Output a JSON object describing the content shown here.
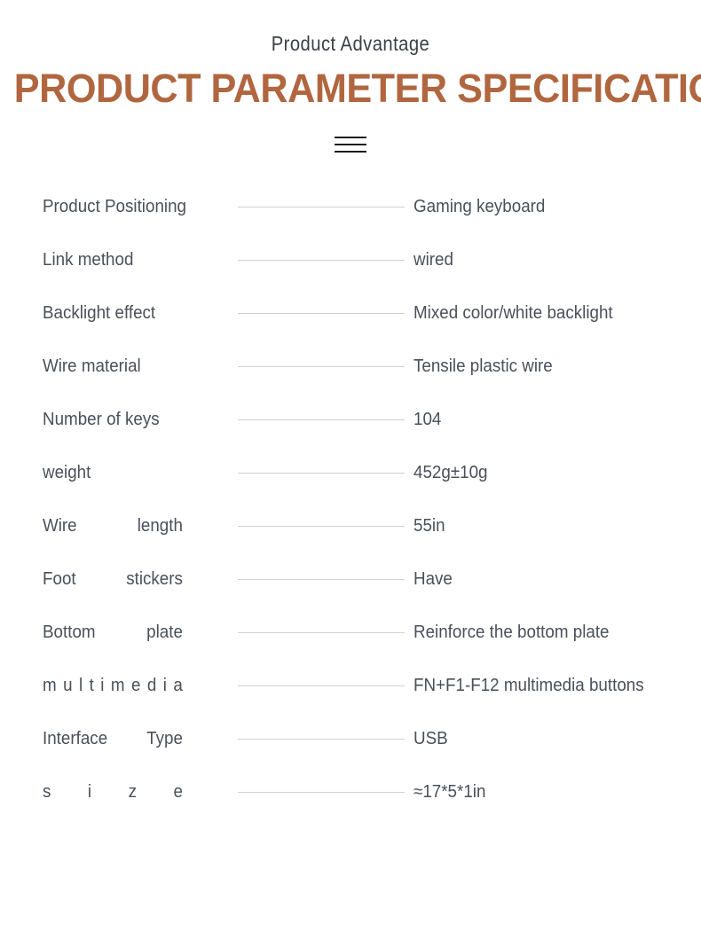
{
  "header": {
    "subtitle": "Product Advantage",
    "title": "PRODUCT PARAMETER SPECIFICATIONS",
    "title_color": "#b0663f",
    "divider_icon": "three-bars-divider",
    "divider_color": "#1a1a1a"
  },
  "spec_table": {
    "label_color": "#4a4f5a",
    "value_color": "#4a4f5a",
    "line_color": "#cfd1d6",
    "rows": [
      {
        "label": "Product Positioning",
        "value": "Gaming keyboard",
        "style": "normal"
      },
      {
        "label": "Link method",
        "value": "wired",
        "style": "normal"
      },
      {
        "label": "Backlight effect",
        "value": "Mixed color/white backlight",
        "style": "normal"
      },
      {
        "label": "Wire material",
        "value": "Tensile plastic wire",
        "style": "normal"
      },
      {
        "label": "Number of keys",
        "value": "104",
        "style": "normal"
      },
      {
        "label": "weight",
        "value": "452g±10g",
        "style": "normal"
      },
      {
        "label": "Wire length",
        "label_parts": [
          "Wire",
          "length"
        ],
        "value": "55in",
        "style": "justify"
      },
      {
        "label": "Foot stickers",
        "label_parts": [
          "Foot",
          "stickers"
        ],
        "value": "Have",
        "style": "justify"
      },
      {
        "label": "Bottom plate",
        "label_parts": [
          "Bottom",
          "plate"
        ],
        "value": "Reinforce the bottom plate",
        "style": "justify"
      },
      {
        "label": "multimedia",
        "label_parts": [
          "m",
          "u",
          "l",
          "t",
          "i",
          "m",
          "e",
          "d",
          "i",
          "a"
        ],
        "value": "FN+F1-F12 multimedia buttons",
        "style": "spread"
      },
      {
        "label": "Interface Type",
        "label_parts": [
          "Interface",
          "Type"
        ],
        "value": "USB",
        "style": "justify"
      },
      {
        "label": "size",
        "label_parts": [
          "s",
          "i",
          "z",
          "e"
        ],
        "value": "≈17*5*1in",
        "style": "spread"
      }
    ]
  }
}
